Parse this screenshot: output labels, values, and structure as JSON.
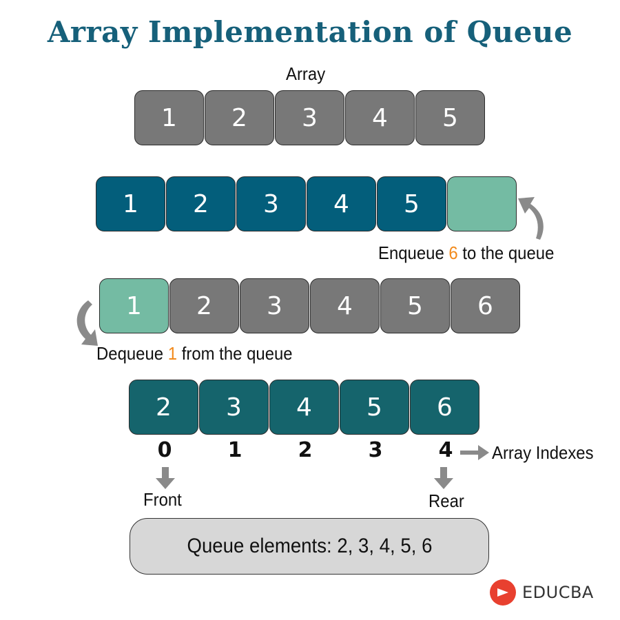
{
  "title": "Array Implementation of Queue",
  "array_label": "Array",
  "rows": {
    "array": [
      "1",
      "2",
      "3",
      "4",
      "5"
    ],
    "enqueue": [
      "1",
      "2",
      "3",
      "4",
      "5",
      ""
    ],
    "dequeue": [
      "1",
      "2",
      "3",
      "4",
      "5",
      "6"
    ],
    "final": [
      "2",
      "3",
      "4",
      "5",
      "6"
    ]
  },
  "enqueue_note": {
    "before": "Enqueue ",
    "value": "6",
    "after": " to the queue"
  },
  "dequeue_note": {
    "before": "Dequeue ",
    "value": "1",
    "after": " from the queue"
  },
  "indexes": [
    "0",
    "1",
    "2",
    "3",
    "4"
  ],
  "indexes_label": "Array Indexes",
  "front_label": "Front",
  "rear_label": "Rear",
  "result": "Queue elements: 2, 3, 4, 5, 6",
  "brand": "EDUCBA",
  "colors": {
    "title": "#16607a",
    "cell_gray": "#787878",
    "cell_blue": "#035e7b",
    "cell_mint": "#74bba3",
    "cell_teal": "#15646c",
    "highlight_number": "#f28a1c",
    "logo_red": "#e8402f"
  }
}
